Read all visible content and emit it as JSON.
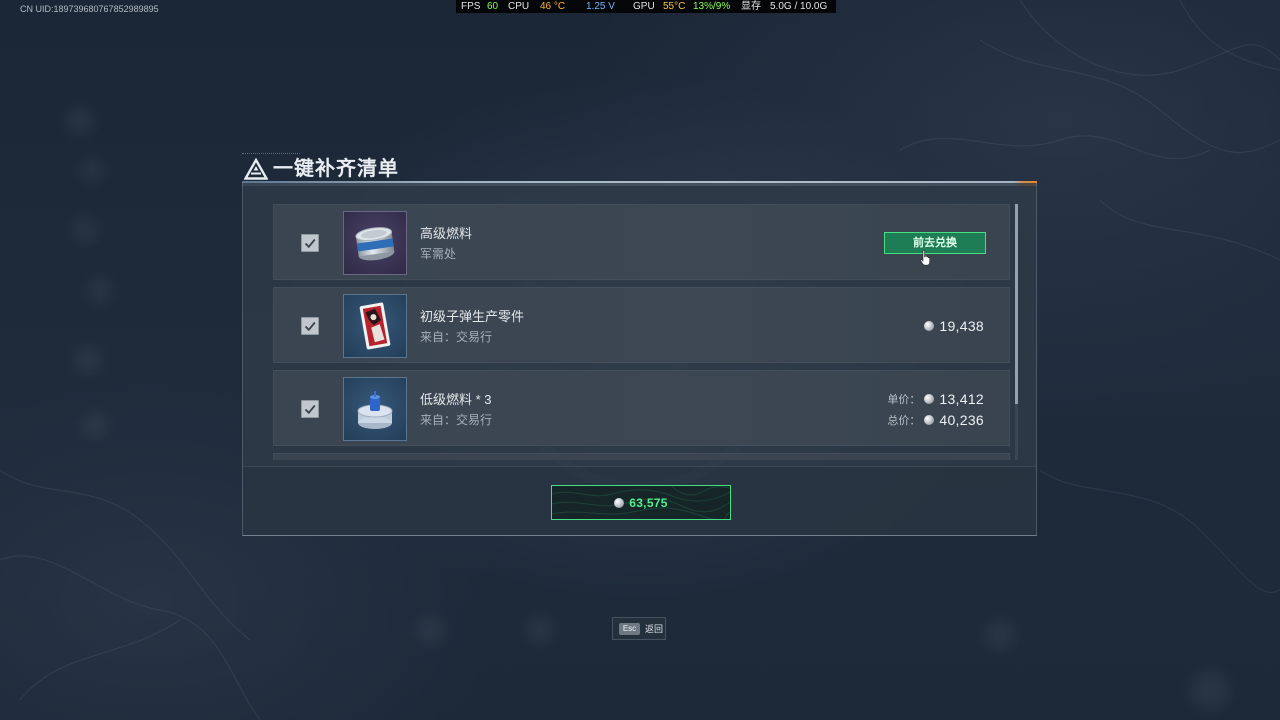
{
  "overlay": {
    "uid": "CN UID:189739680767852989895",
    "perf": {
      "fps_label": "FPS",
      "fps_value": "60",
      "cpu_label": "CPU",
      "cpu_temp": "46 °C",
      "cpu_voltage": "1.25 V",
      "gpu_label": "GPU",
      "gpu_temp": "55°C",
      "gpu_usage": "13%/9%",
      "vram_label": "显存",
      "vram_value": "5.0G / 10.0G"
    }
  },
  "dialog": {
    "title": "一键补齐清单",
    "title_icon": "triangle-logo-icon",
    "items": [
      {
        "checked": true,
        "icon": "fuel-can-icon",
        "name": "高级燃料",
        "source": "军需处",
        "action_label": "前去兑换"
      },
      {
        "checked": true,
        "icon": "bullet-parts-card-icon",
        "name": "初级子弹生产零件",
        "source": "来自：交易行",
        "price": "19,438"
      },
      {
        "checked": true,
        "icon": "fuel-canister-icon",
        "name": "低级燃料 * 3",
        "source": "来自：交易行",
        "unit_price_label": "单价：",
        "unit_price": "13,412",
        "total_price_label": "总价：",
        "total_price": "40,236"
      }
    ],
    "total": {
      "currency_icon": "coin-icon",
      "amount": "63,575"
    }
  },
  "footer_hint": {
    "key": "Esc",
    "label": "返回"
  },
  "theme": {
    "accent_green": "#45e07f",
    "button_fill": "#1f7d55",
    "background": "#1f2b3b"
  }
}
